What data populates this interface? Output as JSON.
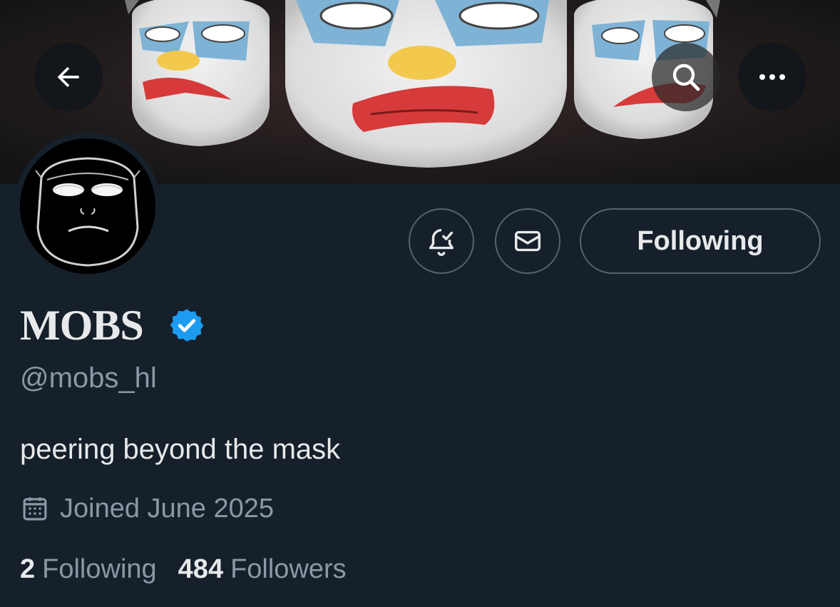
{
  "header": {
    "back_icon": "arrow-left-icon",
    "search_icon": "search-icon",
    "more_icon": "more-horizontal-icon"
  },
  "profile": {
    "display_name": "MOBS",
    "verified_icon": "verified-badge-icon",
    "verified_color": "#1d9bf0",
    "handle": "@mobs_hl",
    "bio": "peering beyond the mask",
    "joined": "Joined June 2025",
    "joined_icon": "calendar-icon"
  },
  "actions": {
    "notify_icon": "bell-check-icon",
    "message_icon": "envelope-icon",
    "follow_label": "Following"
  },
  "stats": {
    "following_count": "2",
    "following_label": "Following",
    "followers_count": "484",
    "followers_label": "Followers"
  },
  "colors": {
    "background": "#15202b",
    "primary_text": "#e7e9ea",
    "secondary_text": "#8b98a5",
    "border": "#536471"
  }
}
